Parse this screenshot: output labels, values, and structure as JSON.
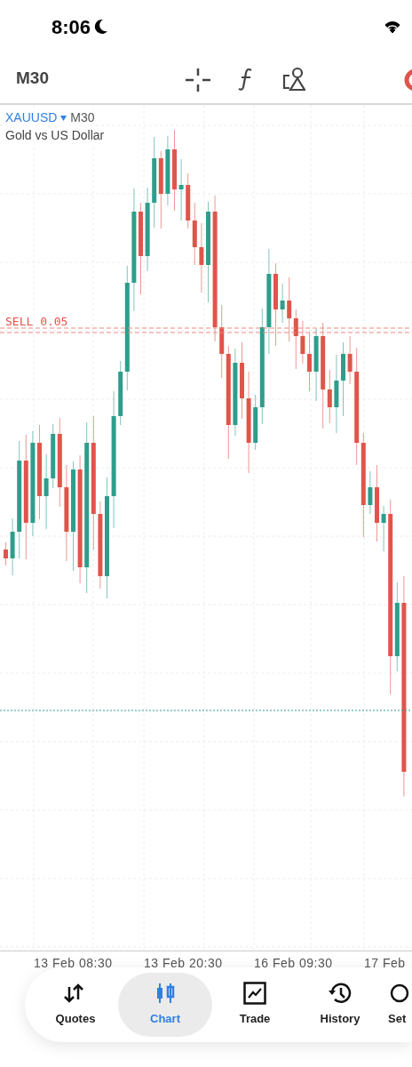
{
  "status_bar": {
    "time": "8:06"
  },
  "toolbar": {
    "timeframe": "M30"
  },
  "chart": {
    "symbol": "XAUUSD",
    "symbol_timeframe": "M30",
    "description": "Gold vs US Dollar",
    "order_label": "SELL 0.05",
    "time_labels": [
      "13 Feb 08:30",
      "13 Feb 20:30",
      "16 Feb 09:30",
      "17 Feb"
    ]
  },
  "tabs": [
    {
      "kind": "quotes",
      "label": "Quotes",
      "selected": false
    },
    {
      "kind": "chart",
      "label": "Chart",
      "selected": true
    },
    {
      "kind": "trade",
      "label": "Trade",
      "selected": false
    },
    {
      "kind": "history",
      "label": "History",
      "selected": false
    },
    {
      "kind": "settings",
      "label": "Set",
      "selected": false
    }
  ]
}
